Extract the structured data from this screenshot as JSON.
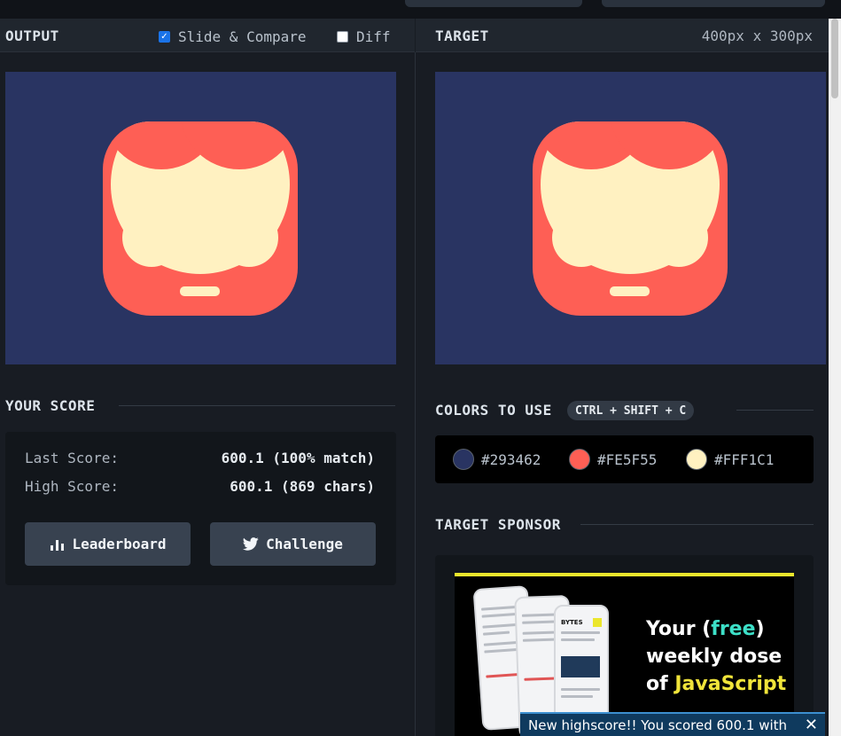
{
  "output_panel": {
    "title": "OUTPUT",
    "slide_compare": {
      "label": "Slide & Compare",
      "checked": true
    },
    "diff": {
      "label": "Diff",
      "checked": false
    }
  },
  "target_panel": {
    "title": "TARGET",
    "dimensions": "400px x 300px"
  },
  "score": {
    "title": "YOUR SCORE",
    "last_label": "Last Score:",
    "last_value": "600.1 (100% match)",
    "high_label": "High Score:",
    "high_value": "600.1 (869 chars)",
    "leaderboard_label": "Leaderboard",
    "challenge_label": "Challenge"
  },
  "colors": {
    "title": "COLORS TO USE",
    "shortcut": "CTRL + SHIFT + C",
    "swatches": [
      {
        "hex": "#293462"
      },
      {
        "hex": "#FE5F55"
      },
      {
        "hex": "#FFF1C1"
      }
    ]
  },
  "sponsor": {
    "title": "TARGET SPONSOR",
    "ad_line1_a": "Your (",
    "ad_line1_b": "free",
    "ad_line1_c": ")",
    "ad_line2": "weekly dose",
    "ad_line3_a": "of ",
    "ad_line3_b": "JavaScript",
    "phone_badge": "BYTES"
  },
  "toast": {
    "text": "New highscore!! You scored 600.1 with"
  },
  "palette": {
    "bg": "#293462",
    "face": "#FE5F55",
    "cream": "#FFF1C1"
  }
}
